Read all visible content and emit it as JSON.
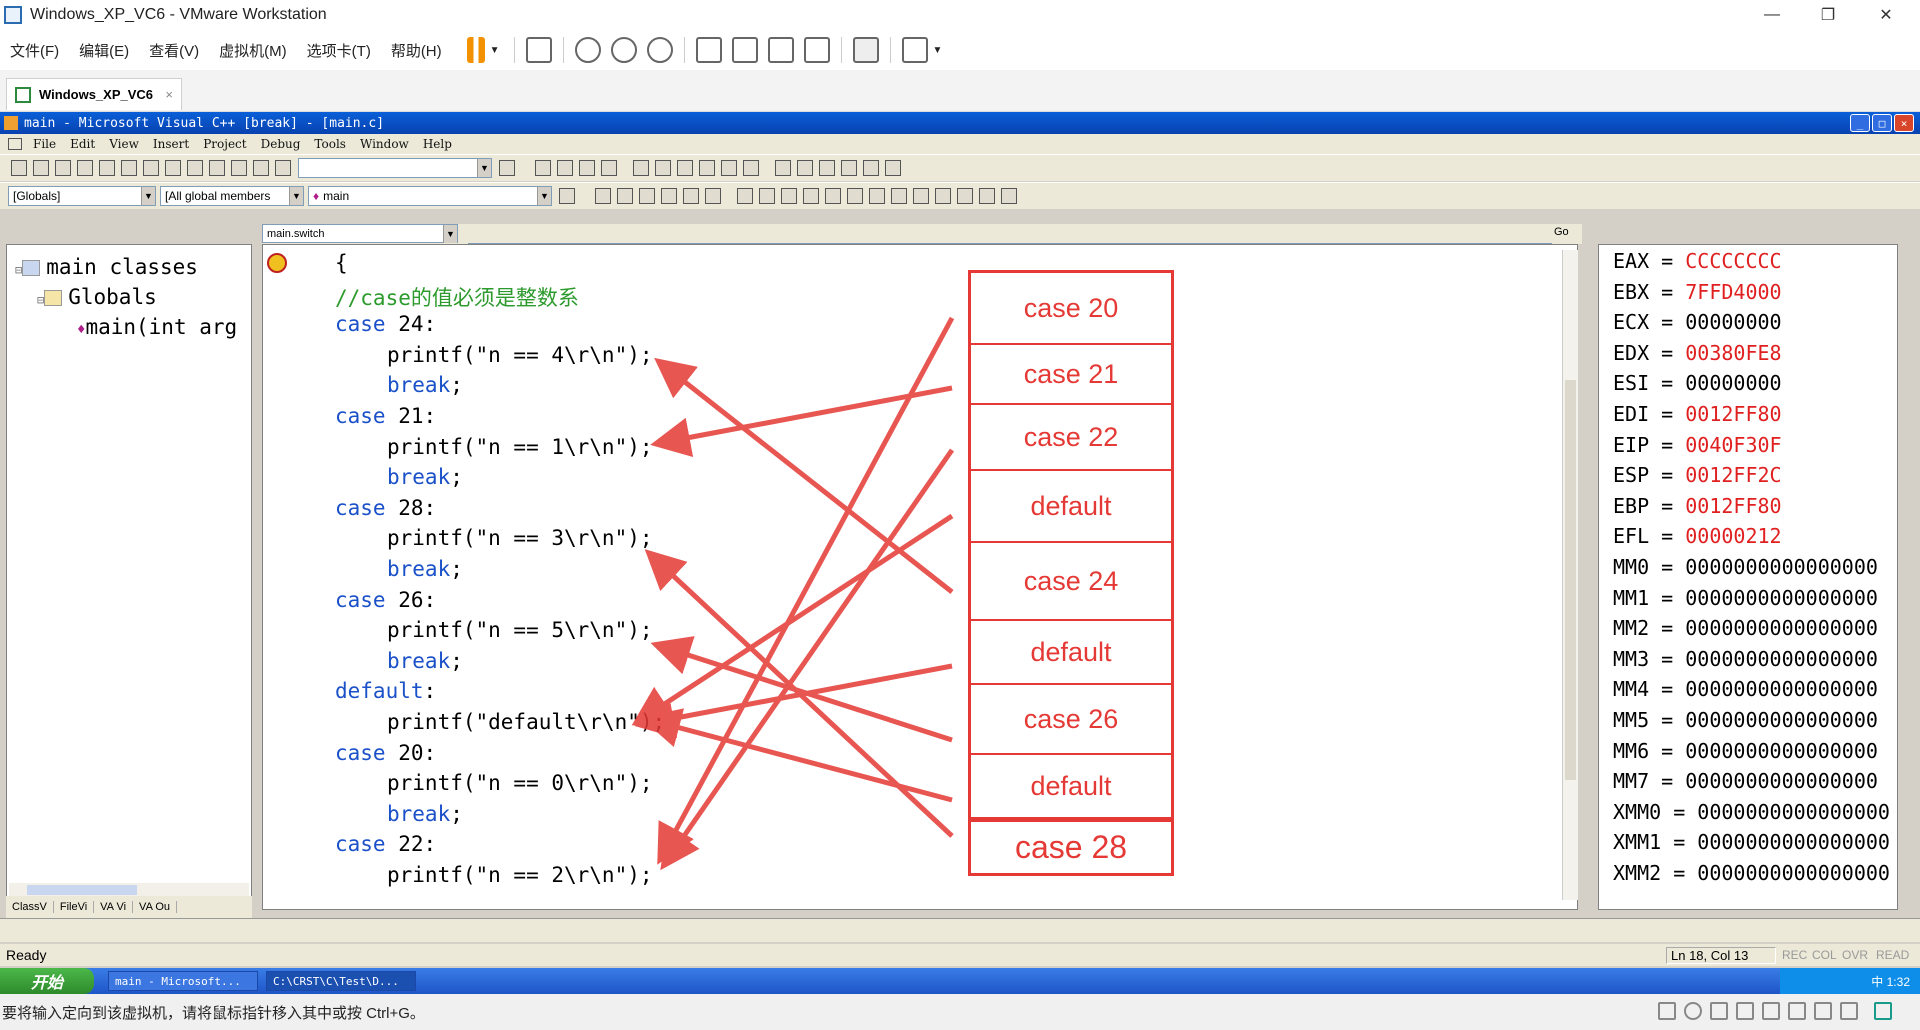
{
  "vmware": {
    "window_title": "Windows_XP_VC6 - VMware Workstation",
    "menu": [
      "文件(F)",
      "编辑(E)",
      "查看(V)",
      "虚拟机(M)",
      "选项卡(T)",
      "帮助(H)"
    ],
    "tab_label": "Windows_XP_VC6",
    "tab_close": "×",
    "status_message": "要将输入定向到该虚拟机，请将鼠标指针移入其中或按 Ctrl+G。",
    "win_min": "—",
    "win_restore": "❐",
    "win_close": "✕"
  },
  "vc": {
    "title": "main - Microsoft Visual C++ [break] - [main.c]",
    "menu": [
      "File",
      "Edit",
      "View",
      "Insert",
      "Project",
      "Debug",
      "Tools",
      "Window",
      "Help"
    ],
    "combo_globals": "[Globals]",
    "combo_members": "[All global members",
    "combo_main": "main",
    "combo_scope": "main.switch",
    "classview": {
      "root": "main classes",
      "globals": "Globals",
      "func": "main(int arg"
    },
    "classview_tabs": [
      "ClassV",
      "FileVi",
      "VA Vi",
      "VA Ou"
    ],
    "status_ready": "Ready",
    "status_pos": "Ln 18, Col 13",
    "status_ind": [
      "REC",
      "COL",
      "OVR",
      "READ"
    ],
    "go_label": "Go"
  },
  "code_lines": [
    {
      "text": "{",
      "cls": "",
      "indent": 0
    },
    {
      "text": "//case的值必须是整数系",
      "cls": "cm",
      "indent": 0
    },
    {
      "kw": "case",
      "text": " 24:",
      "indent": 0
    },
    {
      "text": "printf(\"n == 4\\r\\n\");",
      "cls": "",
      "indent": 1
    },
    {
      "kw": "break",
      "text": ";",
      "indent": 1
    },
    {
      "kw": "case",
      "text": " 21:",
      "indent": 0
    },
    {
      "text": "printf(\"n == 1\\r\\n\");",
      "cls": "",
      "indent": 1
    },
    {
      "kw": "break",
      "text": ";",
      "indent": 1
    },
    {
      "kw": "case",
      "text": " 28:",
      "indent": 0
    },
    {
      "text": "printf(\"n == 3\\r\\n\");",
      "cls": "",
      "indent": 1
    },
    {
      "kw": "break",
      "text": ";",
      "indent": 1
    },
    {
      "kw": "case",
      "text": " 26:",
      "indent": 0
    },
    {
      "text": "printf(\"n == 5\\r\\n\");",
      "cls": "",
      "indent": 1
    },
    {
      "kw": "break",
      "text": ";",
      "indent": 1
    },
    {
      "kw": "default",
      "text": ":",
      "indent": 0
    },
    {
      "text": "printf(\"default\\r\\n\");",
      "cls": "",
      "indent": 1
    },
    {
      "kw": "case",
      "text": " 20:",
      "indent": 0
    },
    {
      "text": "printf(\"n == 0\\r\\n\");",
      "cls": "",
      "indent": 1
    },
    {
      "kw": "break",
      "text": ";",
      "indent": 1
    },
    {
      "kw": "case",
      "text": " 22:",
      "indent": 0
    },
    {
      "text": "printf(\"n == 2\\r\\n\");",
      "cls": "",
      "indent": 1
    }
  ],
  "registers": [
    {
      "name": "EAX",
      "value": "CCCCCCCC",
      "changed": true
    },
    {
      "name": "EBX",
      "value": "7FFD4000",
      "changed": true
    },
    {
      "name": "ECX",
      "value": "00000000",
      "changed": false
    },
    {
      "name": "EDX",
      "value": "00380FE8",
      "changed": true
    },
    {
      "name": "ESI",
      "value": "00000000",
      "changed": false
    },
    {
      "name": "EDI",
      "value": "0012FF80",
      "changed": true
    },
    {
      "name": "EIP",
      "value": "0040F30F",
      "changed": true
    },
    {
      "name": "ESP",
      "value": "0012FF2C",
      "changed": true
    },
    {
      "name": "EBP",
      "value": "0012FF80",
      "changed": true
    },
    {
      "name": "EFL",
      "value": "00000212",
      "changed": true
    },
    {
      "name": "MM0",
      "value": "0000000000000000",
      "changed": false
    },
    {
      "name": "MM1",
      "value": "0000000000000000",
      "changed": false
    },
    {
      "name": "MM2",
      "value": "0000000000000000",
      "changed": false
    },
    {
      "name": "MM3",
      "value": "0000000000000000",
      "changed": false
    },
    {
      "name": "MM4",
      "value": "0000000000000000",
      "changed": false
    },
    {
      "name": "MM5",
      "value": "0000000000000000",
      "changed": false
    },
    {
      "name": "MM6",
      "value": "0000000000000000",
      "changed": false
    },
    {
      "name": "MM7",
      "value": "0000000000000000",
      "changed": false
    },
    {
      "name": "XMM0",
      "value": "0000000000000000",
      "changed": false
    },
    {
      "name": "XMM1",
      "value": "0000000000000000",
      "changed": false
    },
    {
      "name": "XMM2",
      "value": "0000000000000000",
      "changed": false
    }
  ],
  "jump_table": [
    "case 20",
    "case 21",
    "case 22",
    "default",
    "case 24",
    "default",
    "case 26",
    "default",
    "case 28"
  ],
  "taskbar": {
    "start": "开始",
    "tasks": [
      "main - Microsoft...",
      "C:\\CRST\\C\\Test\\D..."
    ],
    "tray": "中  1:32"
  },
  "colors": {
    "annotation": "#e53935",
    "changed_register": "#e02020",
    "keyword": "#1a50c8",
    "comment": "#2c9a2c"
  }
}
